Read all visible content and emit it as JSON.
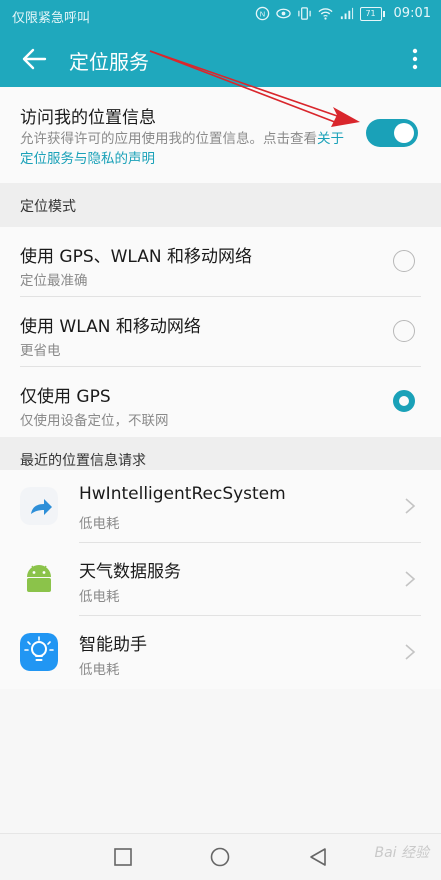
{
  "status_bar": {
    "carrier_text": "仅限紧急呼叫",
    "battery": "71",
    "time": "09:01"
  },
  "app_bar": {
    "title": "定位服务",
    "back_icon": "arrow-left-icon",
    "more_icon": "more-vertical-icon"
  },
  "location_access": {
    "title": "访问我的位置信息",
    "desc_prefix": "允许获得许可的应用使用我的位置信息。点击查看",
    "desc_link": "关于定位服务与隐私的声明",
    "enabled": true
  },
  "location_mode": {
    "header": "定位模式",
    "options": [
      {
        "label": "使用 GPS、WLAN 和移动网络",
        "sub": "定位最准确",
        "selected": false
      },
      {
        "label": "使用 WLAN 和移动网络",
        "sub": "更省电",
        "selected": false
      },
      {
        "label": "仅使用 GPS",
        "sub": "仅使用设备定位，不联网",
        "selected": true
      }
    ]
  },
  "recent_requests": {
    "header": "最近的位置信息请求",
    "apps": [
      {
        "name": "HwIntelligentRecSystem",
        "usage": "低电耗",
        "icon": "share-arrow-icon"
      },
      {
        "name": "天气数据服务",
        "usage": "低电耗",
        "icon": "android-icon"
      },
      {
        "name": "智能助手",
        "usage": "低电耗",
        "icon": "lightbulb-icon"
      }
    ]
  },
  "nav_bar": {
    "recents_icon": "square-icon",
    "home_icon": "circle-icon",
    "back_icon": "triangle-back-icon"
  },
  "watermark": "Bai 经验",
  "colors": {
    "accent": "#1fa8bd",
    "toggle_on": "#1aa1b8",
    "annotation_arrow": "#d9262c"
  }
}
